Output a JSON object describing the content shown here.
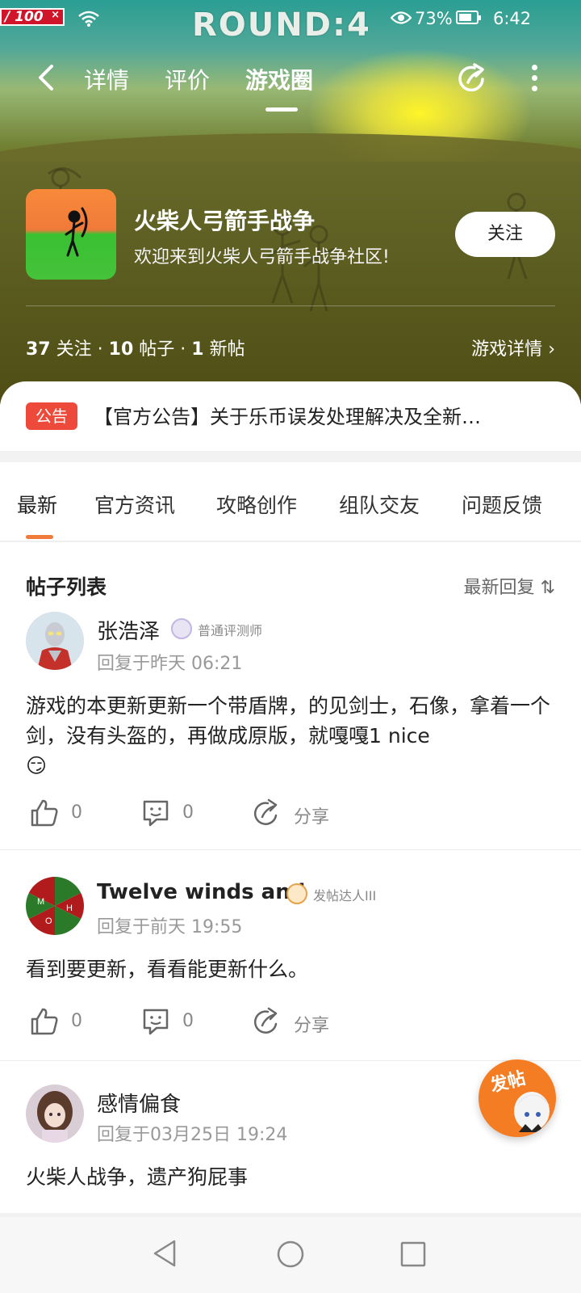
{
  "status_bar": {
    "hp_text": "/ 100",
    "hp_close": "×",
    "round_text": "ROUND:4",
    "battery_pct": "73%",
    "time": "6:42"
  },
  "nav": {
    "tabs": [
      {
        "label": "详情"
      },
      {
        "label": "评价"
      },
      {
        "label": "游戏圈"
      }
    ],
    "active_tab": "游戏圈"
  },
  "game": {
    "title": "火柴人弓箭手战争",
    "subtitle": "欢迎来到火柴人弓箭手战争社区!",
    "follow_label": "关注",
    "stats": {
      "follows_num": "37",
      "follows_label": "关注",
      "posts_num": "10",
      "posts_label": "帖子",
      "new_num": "1",
      "new_label": "新帖",
      "sep": "·"
    },
    "detail_link": "游戏详情"
  },
  "notice": {
    "badge": "公告",
    "text": "【官方公告】关于乐币误发处理解决及全新…"
  },
  "categories": [
    {
      "label": "最新"
    },
    {
      "label": "官方资讯"
    },
    {
      "label": "攻略创作"
    },
    {
      "label": "组队交友"
    },
    {
      "label": "问题反馈"
    }
  ],
  "list": {
    "heading": "帖子列表",
    "sort_label": "最新回复",
    "sort_icon": "⇅"
  },
  "posts": [
    {
      "user": "张浩泽",
      "badge": "普通评测师",
      "time": "回复于昨天 06:21",
      "body": "游戏的本更新更新一个带盾牌，的见剑士，石像，拿着一个剑，没有头盔的，再做成原版，就嘎嘎1 nice",
      "emoji": "😏",
      "likes": "0",
      "comments": "0",
      "share": "分享"
    },
    {
      "user": "Twelve winds and",
      "badge": "发帖达人III",
      "avatar_letters": [
        "M",
        "H",
        "O"
      ],
      "time": "回复于前天 19:55",
      "body": "看到要更新，看看能更新什么。",
      "likes": "0",
      "comments": "0",
      "share": "分享"
    },
    {
      "user": "感情偏食",
      "time": "回复于03月25日 19:24",
      "body": "火柴人战争，遗产狗屁事"
    }
  ],
  "fab": {
    "label": "发帖"
  },
  "colors": {
    "accent": "#f07a3a",
    "notice_badge": "#ee4a3c",
    "fab": "#f47c22"
  }
}
